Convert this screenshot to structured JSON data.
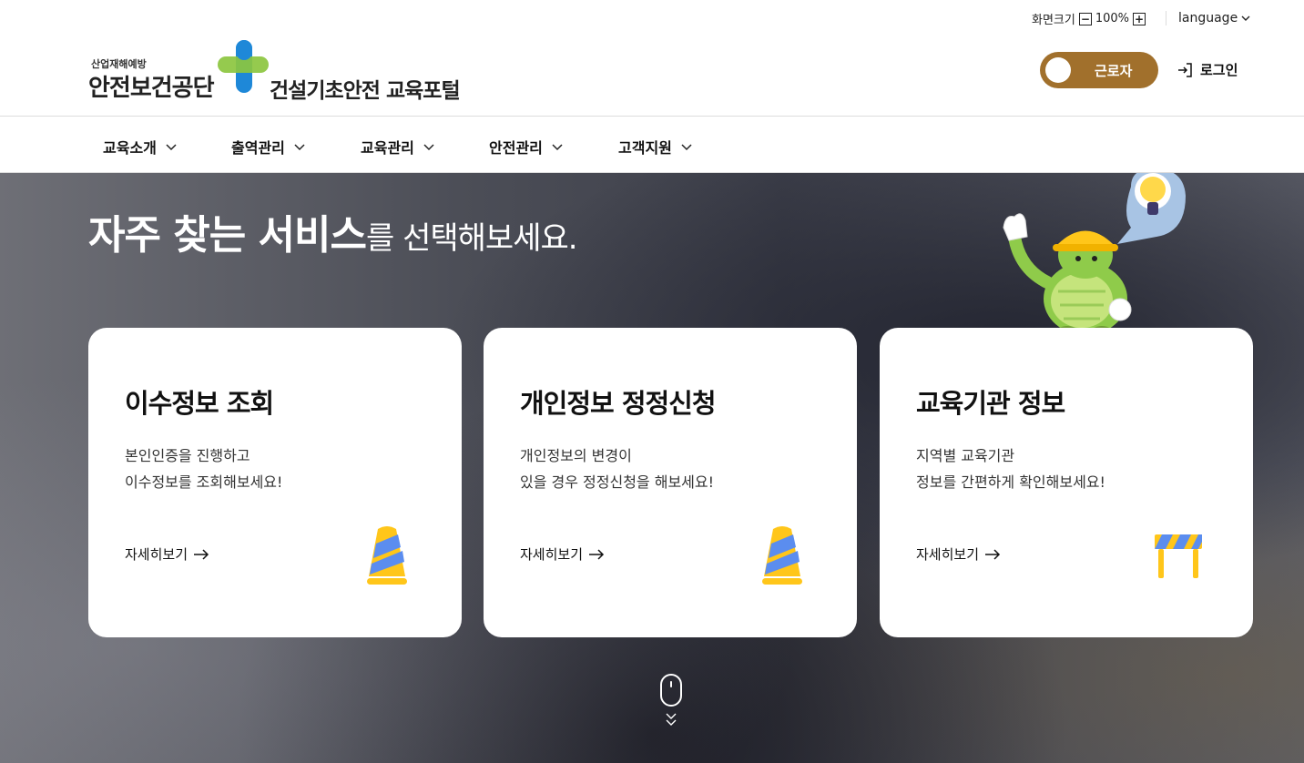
{
  "utility": {
    "zoom_label": "화면크기",
    "zoom_minus": "−",
    "zoom_value": "100%",
    "zoom_plus": "+",
    "language": "language"
  },
  "header": {
    "logo_small": "산업재해예방",
    "logo_org": "안전보건공단",
    "logo_portal": "건설기초안전 교육포털",
    "toggle_label": "근로자",
    "login": "로그인"
  },
  "nav": {
    "items": [
      {
        "label": "교육소개"
      },
      {
        "label": "출역관리"
      },
      {
        "label": "교육관리"
      },
      {
        "label": "안전관리"
      },
      {
        "label": "고객지원"
      }
    ]
  },
  "hero": {
    "title_strong": "자주 찾는 서비스",
    "title_light": "를 선택해보세요."
  },
  "cards": [
    {
      "title": "이수정보 조회",
      "desc1": "본인인증을 진행하고",
      "desc2": "이수정보를 조회해보세요!",
      "more": "자세히보기",
      "icon": "traffic-cone-icon"
    },
    {
      "title": "개인정보 정정신청",
      "desc1": "개인정보의 변경이",
      "desc2": "있을 경우 정정신청을 해보세요!",
      "more": "자세히보기",
      "icon": "traffic-cone-icon"
    },
    {
      "title": "교육기관 정보",
      "desc1": "지역별 교육기관",
      "desc2": "정보를 간편하게 확인해보세요!",
      "more": "자세히보기",
      "icon": "barricade-icon"
    }
  ],
  "colors": {
    "accent_gold": "#a1702c",
    "logo_green": "#8cc63f",
    "logo_blue": "#1e88d8",
    "icon_yellow": "#ffc61a",
    "icon_blue": "#5b8def"
  }
}
